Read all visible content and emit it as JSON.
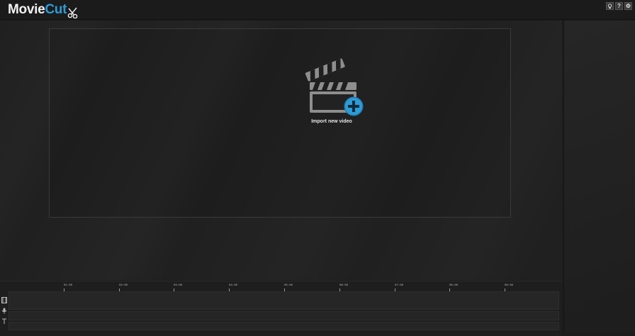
{
  "app": {
    "logo_part1": "Movie",
    "logo_part2": "Cut",
    "accent_color": "#2d9bd6"
  },
  "header_actions": [
    {
      "name": "bulb-icon",
      "glyph": "💡"
    },
    {
      "name": "help-icon",
      "glyph": "?"
    },
    {
      "name": "settings-icon",
      "glyph": "⚙"
    }
  ],
  "stage": {
    "import_label": "Import new video"
  },
  "timeline": {
    "ticks": [
      "01:00",
      "02:00",
      "03:00",
      "04:00",
      "05:00",
      "06:00",
      "07:00",
      "08:00",
      "09:00"
    ],
    "tracks": [
      "video-track",
      "audio-track",
      "text-track"
    ]
  }
}
